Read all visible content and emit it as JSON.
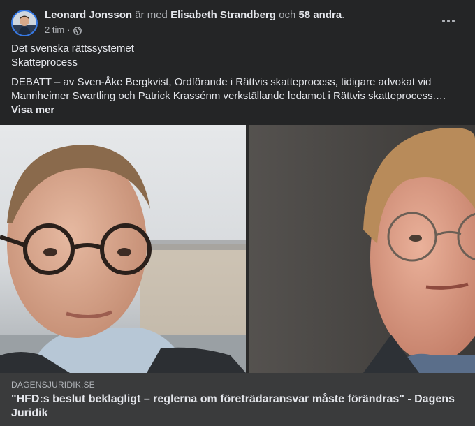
{
  "post": {
    "author": "Leonard Jonsson",
    "with_text": "är med",
    "tagged": "Elisabeth Strandberg",
    "and_text": "och",
    "others": "58 andra",
    "period": ".",
    "time": "2 tim",
    "dot": "·",
    "privacy_icon": "globe-icon",
    "menu_icon": "more-options-icon",
    "body_line1": "Det svenska rättssystemet",
    "body_line2": "Skatteprocess",
    "body_line3": "DEBATT – av Sven-Åke Bergkvist, Ordförande i Rättvis skatteprocess, tidigare advokat vid",
    "body_line4": "Mannheimer Swartling och Patrick Krassénm verkställande ledamot i Rättvis skatteprocess.…",
    "see_more": "Visa mer"
  },
  "link": {
    "domain": "DAGENSJURIDIK.SE",
    "title": "\"HFD:s beslut beklagligt – reglerna om företrädaransvar måste förändras\" - Dagens Juridik"
  },
  "colors": {
    "background": "#242526",
    "link_background": "#3a3b3c",
    "primary_text": "#e4e6eb",
    "secondary_text": "#b0b3b8"
  }
}
